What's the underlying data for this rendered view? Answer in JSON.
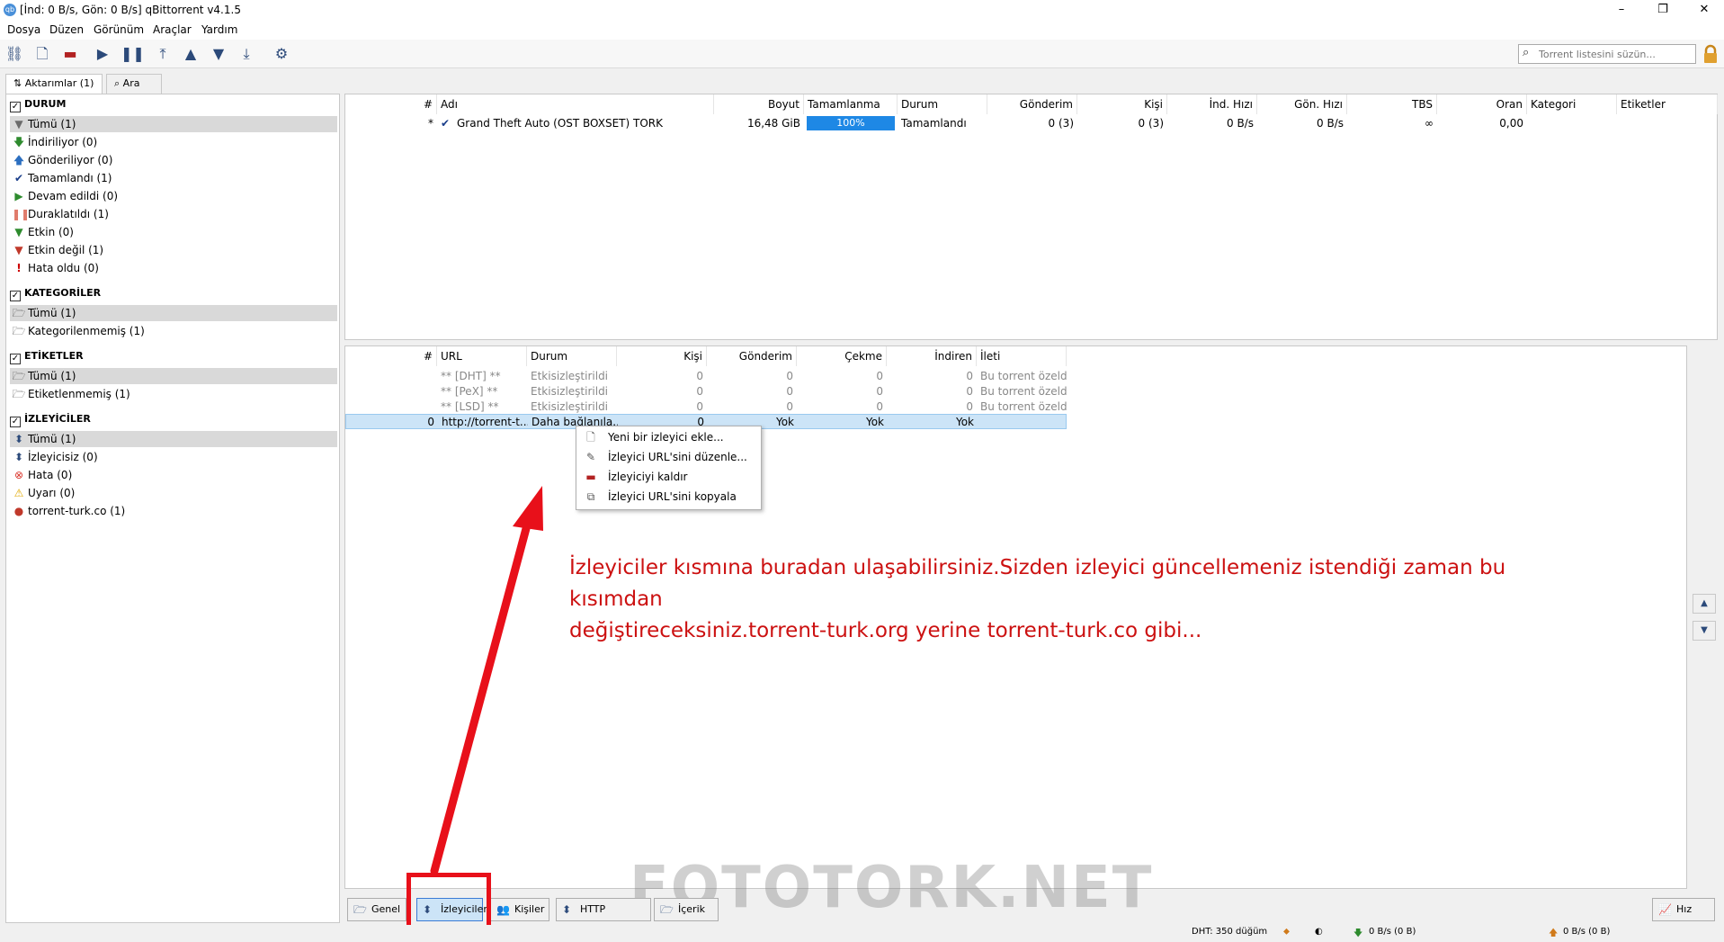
{
  "window": {
    "title": "[İnd: 0 B/s, Gön: 0 B/s] qBittorrent v4.1.5",
    "app_icon": "qb-icon",
    "controls": [
      "–",
      "❐",
      "✕"
    ]
  },
  "menu": [
    "Dosya",
    "Düzen",
    "Görünüm",
    "Araçlar",
    "Yardım"
  ],
  "toolbar": {
    "icons": [
      "add-link-icon",
      "add-file-icon",
      "remove-icon",
      "resume-icon",
      "pause-icon",
      "top-icon",
      "up-icon",
      "down-icon",
      "bottom-icon",
      "options-icon"
    ],
    "search_placeholder": "Torrent listesini süzün..."
  },
  "top_tabs": [
    {
      "label": "Aktarımlar (1)",
      "icon": "transfers-icon"
    },
    {
      "label": "Ara",
      "icon": "search-icon"
    }
  ],
  "sidebar": {
    "status": {
      "title": "DURUM",
      "items": [
        {
          "label": "Tümü (1)",
          "icon": "filter-icon",
          "color": "#6b6b6b"
        },
        {
          "label": "İndiriliyor (0)",
          "icon": "down-arrow-icon",
          "color": "#2e8b2e"
        },
        {
          "label": "Gönderiliyor (0)",
          "icon": "up-arrow-icon",
          "color": "#2c6fc0"
        },
        {
          "label": "Tamamlandı (1)",
          "icon": "check-icon",
          "color": "#1a3e8a"
        },
        {
          "label": "Devam edildi (0)",
          "icon": "play-icon",
          "color": "#2e8b2e"
        },
        {
          "label": "Duraklatıldı (1)",
          "icon": "pause-icon",
          "color": "#e07b6b"
        },
        {
          "label": "Etkin (0)",
          "icon": "filter-icon",
          "color": "#2e8b2e"
        },
        {
          "label": "Etkin değil (1)",
          "icon": "filter-icon",
          "color": "#c0392b"
        },
        {
          "label": "Hata oldu (0)",
          "icon": "exclamation-icon",
          "color": "#cc0000"
        }
      ]
    },
    "categories": {
      "title": "KATEGORİLER",
      "items": [
        {
          "label": "Tümü (1)",
          "icon": "folder-icon"
        },
        {
          "label": "Kategorilenmemiş (1)",
          "icon": "folder-icon"
        }
      ]
    },
    "tags": {
      "title": "ETİKETLER",
      "items": [
        {
          "label": "Tümü (1)",
          "icon": "folder-icon"
        },
        {
          "label": "Etiketlenmemiş (1)",
          "icon": "folder-icon"
        }
      ]
    },
    "trackers": {
      "title": "İZLEYİCİLER",
      "items": [
        {
          "label": "Tümü (1)",
          "icon": "tracker-icon"
        },
        {
          "label": "İzleyicisiz (0)",
          "icon": "tracker-icon"
        },
        {
          "label": "Hata (0)",
          "icon": "error-icon"
        },
        {
          "label": "Uyarı (0)",
          "icon": "warning-icon"
        },
        {
          "label": "torrent-turk.co (1)",
          "icon": "site-favicon"
        }
      ]
    }
  },
  "torrent_table": {
    "headers": [
      "#",
      "Adı",
      "Boyut",
      "Tamamlanma",
      "Durum",
      "Gönderim",
      "Kişi",
      "İnd. Hızı",
      "Gön. Hızı",
      "TBS",
      "Oran",
      "Kategori",
      "Etiketler"
    ],
    "rows": [
      {
        "num": "*",
        "name": "Grand Theft Auto (OST BOXSET) TORK",
        "size": "16,48 GiB",
        "progress_label": "100%",
        "progress": 1.0,
        "status": "Tamamlandı",
        "seeds": "0 (3)",
        "peers": "0 (3)",
        "dl": "0 B/s",
        "ul": "0 B/s",
        "eta": "∞",
        "ratio": "0,00"
      }
    ]
  },
  "tracker_table": {
    "headers": [
      "#",
      "URL",
      "Durum",
      "Kişi",
      "Gönderim",
      "Çekme",
      "İndiren",
      "İleti"
    ],
    "rows": [
      {
        "num": "",
        "url": "** [DHT] **",
        "status": "Etkisizleştirildi",
        "peers": "0",
        "seeds": "0",
        "leech": "0",
        "down": "0",
        "msg": "Bu torrent özeldir",
        "disabled": true
      },
      {
        "num": "",
        "url": "** [PeX] **",
        "status": "Etkisizleştirildi",
        "peers": "0",
        "seeds": "0",
        "leech": "0",
        "down": "0",
        "msg": "Bu torrent özeldir",
        "disabled": true
      },
      {
        "num": "",
        "url": "** [LSD] **",
        "status": "Etkisizleştirildi",
        "peers": "0",
        "seeds": "0",
        "leech": "0",
        "down": "0",
        "msg": "Bu torrent özeldir",
        "disabled": true
      },
      {
        "num": "0",
        "url": "http://torrent-t...",
        "status": "Daha bağlanıla...",
        "peers": "0",
        "seeds": "Yok",
        "leech": "Yok",
        "down": "Yok",
        "msg": "",
        "disabled": false
      }
    ]
  },
  "context_menu": [
    {
      "label": "Yeni bir izleyici ekle...",
      "icon": "add-tracker-icon"
    },
    {
      "label": "İzleyici URL'sini düzenle...",
      "icon": "edit-icon"
    },
    {
      "label": "İzleyiciyi kaldır",
      "icon": "remove-icon"
    },
    {
      "label": "İzleyici URL'sini kopyala",
      "icon": "copy-icon"
    }
  ],
  "annotation": {
    "line1": "İzleyiciler kısmına buradan ulaşabilirsiniz.Sizden izleyici güncellemeniz istendiği zaman bu kısımdan",
    "line2": "değiştireceksiniz.torrent-turk.org yerine torrent-turk.co gibi...",
    "color": "#cc1111"
  },
  "bottom_tabs": [
    {
      "label": "Genel",
      "icon": "general-icon"
    },
    {
      "label": "İzleyiciler",
      "icon": "tracker-icon",
      "active": true
    },
    {
      "label": "Kişiler",
      "icon": "peers-icon"
    },
    {
      "label": "HTTP Kaynakları",
      "icon": "http-icon"
    },
    {
      "label": "İçerik",
      "icon": "folder-icon"
    }
  ],
  "speed_button": "Hız",
  "watermark": "FOTOTORK.NET",
  "status_bar": {
    "dht": "DHT: 350 düğüm",
    "download": "0 B/s (0 B)",
    "upload": "0 B/s (0 B)"
  }
}
